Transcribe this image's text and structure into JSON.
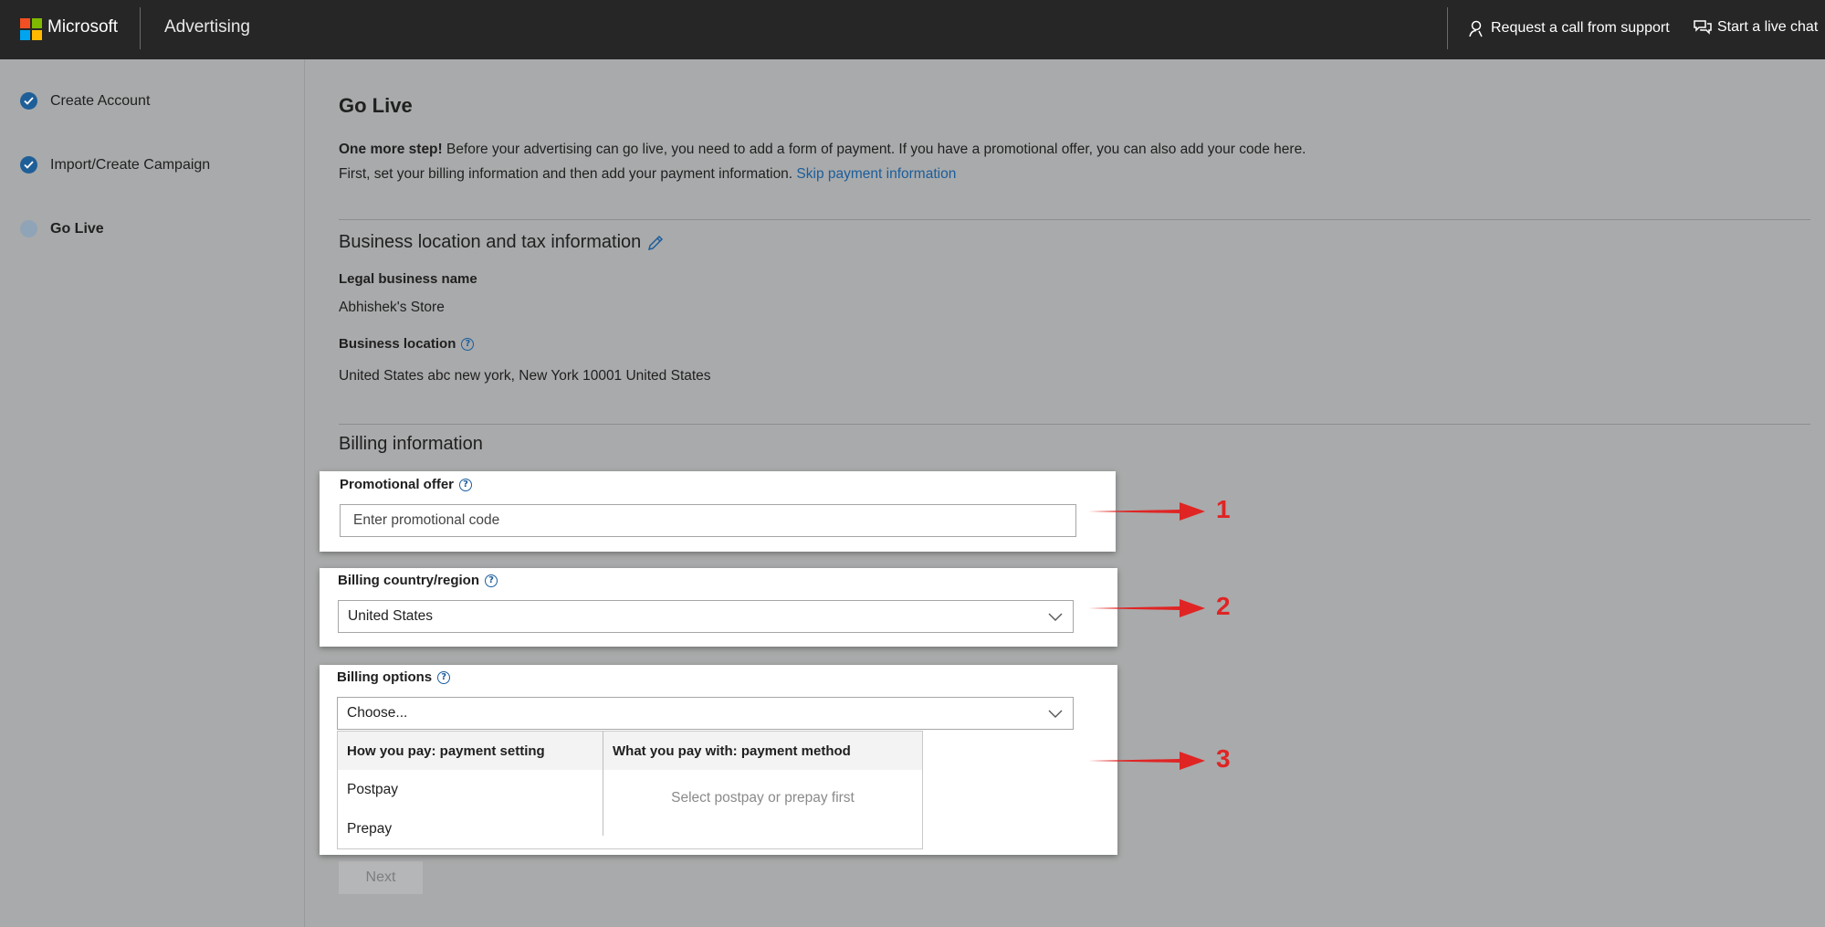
{
  "header": {
    "brand": "Microsoft",
    "product": "Advertising",
    "actions": [
      {
        "label": "Request a call from support",
        "icon": "person-headset-icon"
      },
      {
        "label": "Start a live chat",
        "icon": "chat-bubbles-icon"
      }
    ]
  },
  "colors": {
    "ms_red": "#f25022",
    "ms_green": "#7fba00",
    "ms_blue": "#00a4ef",
    "ms_yellow": "#ffb900",
    "link": "#1a5d9c",
    "annotation": "#e02424"
  },
  "sidebar": {
    "steps": [
      {
        "label": "Create Account",
        "state": "done"
      },
      {
        "label": "Import/Create Campaign",
        "state": "done"
      },
      {
        "label": "Go Live",
        "state": "current"
      }
    ]
  },
  "main": {
    "title": "Go Live",
    "intro": {
      "bold": "One more step!",
      "line1": " Before your advertising can go live, you need to add a form of payment. If you have a promotional offer, you can also add your code here.",
      "line2": "First, set your billing information and then add your payment information. ",
      "link": "Skip payment information"
    },
    "business": {
      "title": "Business location and tax information",
      "legal_name_label": "Legal business name",
      "legal_name_value": "Abhishek's Store",
      "location_label": "Business location",
      "location_value": "United States abc new york, New York 10001 United States"
    },
    "billing": {
      "title": "Billing information",
      "promo_label": "Promotional offer",
      "promo_placeholder": "Enter promotional code",
      "country_label": "Billing country/region",
      "country_value": "United States",
      "options_label": "Billing options",
      "options_value": "Choose...",
      "dropdown": {
        "col1_header": "How you pay: payment setting",
        "col1_items": [
          "Postpay",
          "Prepay"
        ],
        "col2_header": "What you pay with: payment method",
        "col2_empty": "Select postpay or prepay first"
      }
    },
    "next_label": "Next"
  },
  "annotations": [
    "1",
    "2",
    "3"
  ]
}
